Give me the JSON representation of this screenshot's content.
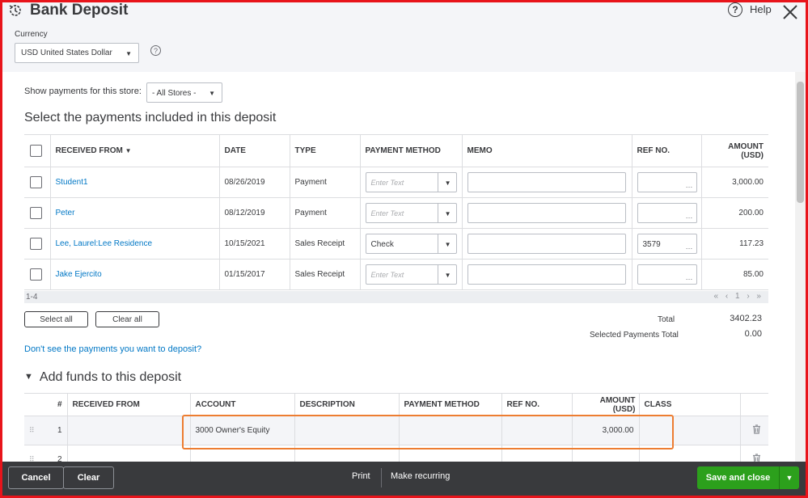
{
  "header": {
    "title": "Bank Deposit",
    "help_label": "Help",
    "currency_label": "Currency",
    "currency_value": "USD United States Dollar"
  },
  "payments": {
    "store_filter_label": "Show payments for this store:",
    "store_filter_value": "- All Stores -",
    "section_title": "Select the payments included in this deposit",
    "columns": [
      "RECEIVED FROM",
      "DATE",
      "TYPE",
      "PAYMENT METHOD",
      "MEMO",
      "REF NO.",
      "AMOUNT (USD)"
    ],
    "method_placeholder": "Enter Text",
    "rows": [
      {
        "received_from": "Student1",
        "date": "08/26/2019",
        "type": "Payment",
        "payment_method": "",
        "ref_no": "",
        "amount": "3,000.00"
      },
      {
        "received_from": "Peter",
        "date": "08/12/2019",
        "type": "Payment",
        "payment_method": "",
        "ref_no": "",
        "amount": "200.00"
      },
      {
        "received_from": "Lee, Laurel:Lee Residence",
        "date": "10/15/2021",
        "type": "Sales Receipt",
        "payment_method": "Check",
        "ref_no": "3579",
        "amount": "117.23"
      },
      {
        "received_from": "Jake Ejercito",
        "date": "01/15/2017",
        "type": "Sales Receipt",
        "payment_method": "",
        "ref_no": "",
        "amount": "85.00"
      }
    ],
    "pager_range": "1-4",
    "pager_nav": "« ‹ 1 › »",
    "select_all_label": "Select all",
    "clear_all_label": "Clear all",
    "total_label": "Total",
    "total_value": "3402.23",
    "selected_total_label": "Selected Payments Total",
    "selected_total_value": "0.00",
    "missing_link": "Don't see the payments you want to deposit?"
  },
  "funds": {
    "section_title": "Add funds to this deposit",
    "columns": [
      "#",
      "RECEIVED FROM",
      "ACCOUNT",
      "DESCRIPTION",
      "PAYMENT METHOD",
      "REF NO.",
      "AMOUNT (USD)",
      "CLASS"
    ],
    "rows": [
      {
        "num": "1",
        "received_from": "",
        "account": "3000 Owner's Equity",
        "description": "",
        "payment_method": "",
        "ref_no": "",
        "amount": "3,000.00",
        "class": ""
      },
      {
        "num": "2",
        "received_from": "",
        "account": "",
        "description": "",
        "payment_method": "",
        "ref_no": "",
        "amount": "",
        "class": ""
      }
    ]
  },
  "footer": {
    "cancel_label": "Cancel",
    "clear_label": "Clear",
    "print_label": "Print",
    "recurring_label": "Make recurring",
    "save_label": "Save and close"
  },
  "colors": {
    "accent_green": "#2ca01c",
    "link_blue": "#0077c5",
    "footer_dark": "#393a3d",
    "highlight_orange": "#ed7d31",
    "frame_red": "#e8141b"
  },
  "icons": [
    "history-icon",
    "help-icon",
    "close-icon",
    "info-icon",
    "sort-down-icon",
    "drag-handle-icon",
    "trash-icon",
    "chevron-down-icon"
  ]
}
